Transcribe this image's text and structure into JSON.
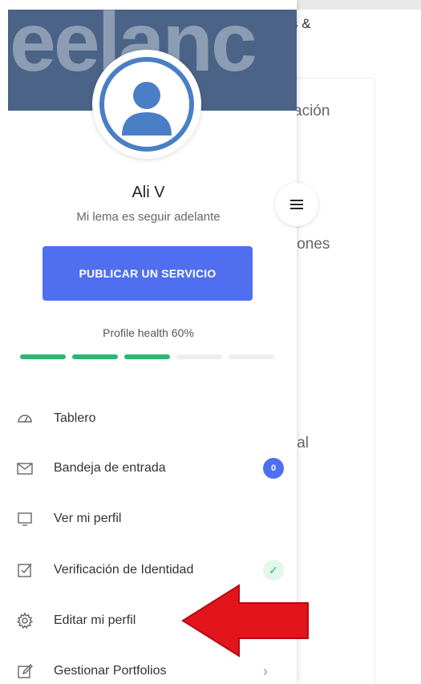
{
  "background": {
    "snippets": [
      "s &",
      "ación",
      "iones",
      "ial"
    ]
  },
  "banner": {
    "text": "eelanc"
  },
  "profile": {
    "name": "Ali V",
    "tagline": "Mi lema es seguir adelante"
  },
  "cta": {
    "label": "PUBLICAR UN SERVICIO"
  },
  "health": {
    "label": "Profile health 60%",
    "percent": 60,
    "segments_total": 5,
    "segments_filled": 3,
    "color": "#2bb673"
  },
  "menu": {
    "items": [
      {
        "label": "Tablero",
        "icon": "dashboard-icon"
      },
      {
        "label": "Bandeja de entrada",
        "icon": "envelope-icon",
        "badge": "0"
      },
      {
        "label": "Ver mi perfil",
        "icon": "monitor-icon"
      },
      {
        "label": "Verificación de Identidad",
        "icon": "checkbox-icon",
        "status": "verified"
      },
      {
        "label": "Editar mi perfil",
        "icon": "gear-icon"
      },
      {
        "label": "Gestionar Portfolios",
        "icon": "pencil-icon",
        "has_submenu": true
      }
    ]
  },
  "colors": {
    "accent": "#4f6ff0",
    "banner": "#4b6386",
    "avatar_ring": "#4a7fc6",
    "annotation_arrow": "#e3141b"
  }
}
